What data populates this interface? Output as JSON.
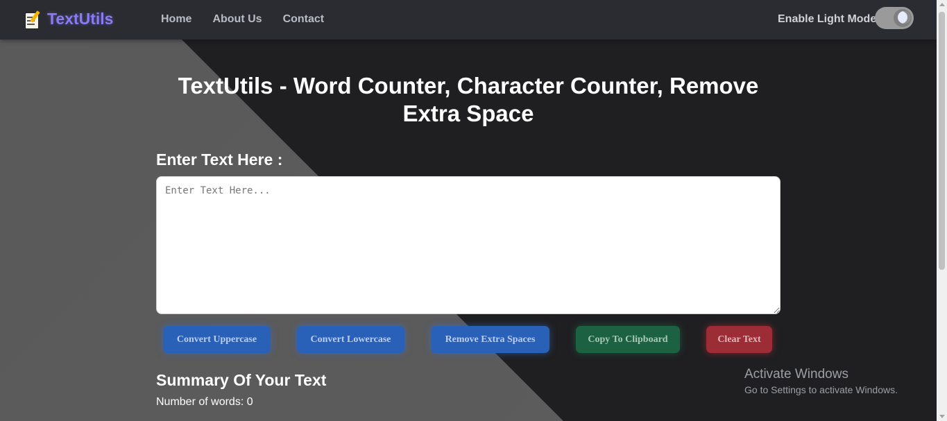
{
  "navbar": {
    "brand": "TextUtils",
    "links": [
      "Home",
      "About Us",
      "Contact"
    ],
    "mode_label": "Enable Light Mode"
  },
  "main": {
    "title": "TextUtils - Word Counter, Character Counter, Remove Extra Space",
    "input_label": "Enter Text Here :",
    "input_placeholder": "Enter Text Here...",
    "input_value": "",
    "buttons": {
      "uppercase": "Convert Uppercase",
      "lowercase": "Convert Lowercase",
      "remove_spaces": "Remove Extra Spaces",
      "copy": "Copy To Clipboard",
      "clear": "Clear Text"
    },
    "summary_title": "Summary Of Your Text",
    "word_count": "Number of words: 0"
  },
  "watermark": {
    "title": "Activate Windows",
    "subtitle": "Go to Settings to activate Windows."
  },
  "colors": {
    "background": "#1f1f21",
    "navbar": "#2a2c31",
    "brand": "#8a7cf0",
    "primary": "#2a61b8",
    "success": "#1c6242",
    "danger": "#9c2c36"
  }
}
